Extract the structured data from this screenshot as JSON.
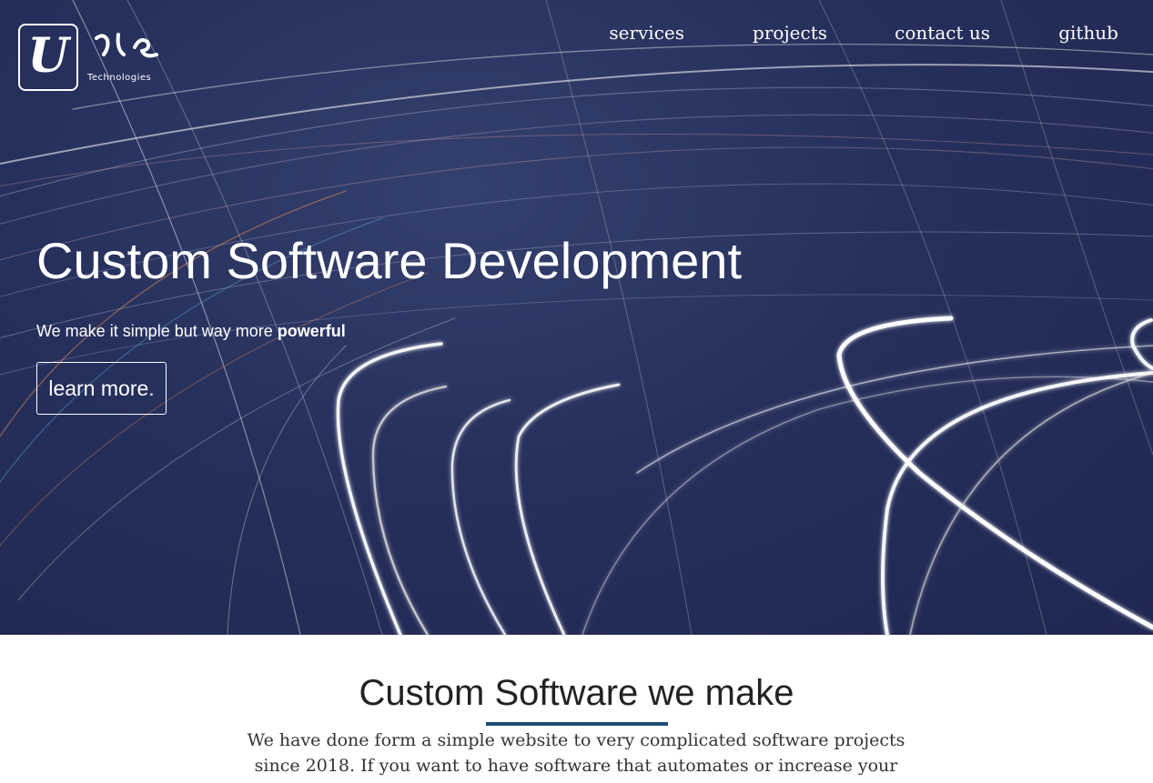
{
  "brand": {
    "logo_letter": "U",
    "script_text": "ነሬ",
    "tagline": "Technologies"
  },
  "nav": {
    "items": [
      {
        "label": "services"
      },
      {
        "label": "projects"
      },
      {
        "label": "contact us"
      },
      {
        "label": "github"
      }
    ]
  },
  "hero": {
    "title": "Custom Software Development",
    "subtitle_prefix": "We make it simple but way more ",
    "subtitle_emphasis": "powerful",
    "button_label": "learn more."
  },
  "section": {
    "title": "Custom Software we make",
    "text": "We have done form a simple website to very complicated software projects since 2018. If you want to have software that automates or increase your"
  },
  "colors": {
    "hero_background": "#26305c",
    "accent_rule": "#1d4c74",
    "text_dark": "#222222"
  }
}
